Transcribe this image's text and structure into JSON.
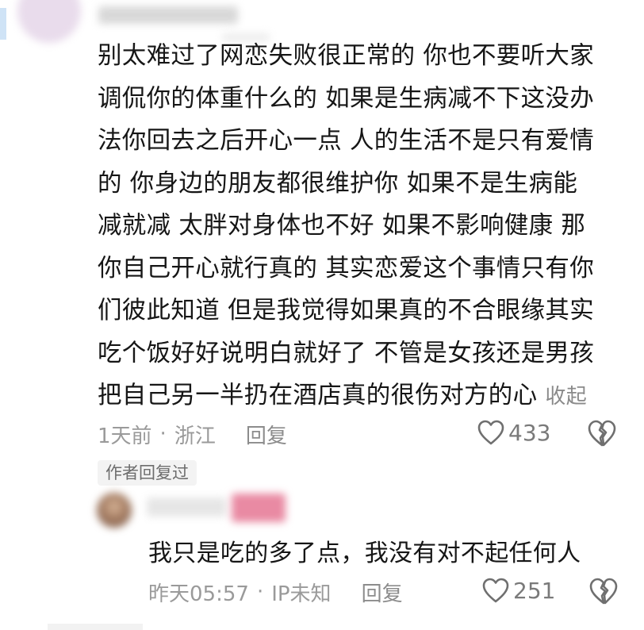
{
  "comment": {
    "lines": [
      "别太难过了网恋失败很正常的 你也不要听大家",
      "调侃你的体重什么的 如果是生病减不下这没办",
      "法你回去之后开心一点 人的生活不是只有爱情",
      "的 你身边的朋友都很维护你 如果不是生病能",
      "减就减 太胖对身体也不好 如果不影响健康 那",
      "你自己开心就行真的 其实恋爱这个事情只有你",
      "们彼此知道 但是我觉得如果真的不合眼缘其实",
      "吃个饭好好说明白就好了 不管是女孩还是男孩",
      "把自己另一半扔在酒店真的很伤对方的心"
    ],
    "collapse_label": "收起",
    "time": "1天前",
    "location": "浙江",
    "separator": "·",
    "reply_label": "回复",
    "likes": "433"
  },
  "author_badge": "作者回复过",
  "reply": {
    "text": "我只是吃的多了点，我没有对不起任何人",
    "time": "昨天05:57",
    "separator": "·",
    "location": "IP未知",
    "reply_label": "回复",
    "likes": "251"
  },
  "colors": {
    "text": "#161616",
    "meta": "#9a9a9a",
    "badge_pink": "#e98aa3"
  },
  "icons": [
    "heart-outline-icon",
    "heart-broken-icon"
  ]
}
